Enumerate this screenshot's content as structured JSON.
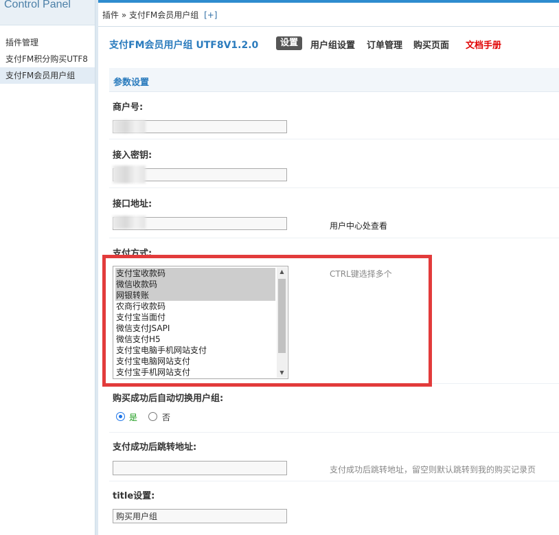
{
  "sidebar": {
    "brand": "Control Panel",
    "items": [
      {
        "label": "插件管理",
        "active": false
      },
      {
        "label": "支付FM积分购买UTF8",
        "active": false
      },
      {
        "label": "支付FM会员用户组",
        "active": true
      }
    ]
  },
  "topbar": {
    "breadcrumb": "插件 » 支付FM会员用户组",
    "add_label": "[+]"
  },
  "header": {
    "plugin_title": "支付FM会员用户组 UTF8V1.2.0",
    "nav": {
      "settings": "设置",
      "group_settings": "用户组设置",
      "orders": "订单管理",
      "buy_page": "购买页面",
      "docs": "文档手册"
    },
    "doc_color": "#e00000"
  },
  "section": {
    "title": "参数设置"
  },
  "fields": {
    "merchant_id": {
      "label": "商户号:",
      "value": ""
    },
    "access_key": {
      "label": "接入密钥:",
      "value": ""
    },
    "api_url": {
      "label": "接口地址:",
      "value": "",
      "hint": "用户中心处查看"
    },
    "payment_methods": {
      "label": "支付方式:",
      "hint": "CTRL键选择多个",
      "options": [
        {
          "label": "支付宝收款码",
          "selected": true
        },
        {
          "label": "微信收款码",
          "selected": true
        },
        {
          "label": "网银转账",
          "selected": true
        },
        {
          "label": "农商行收款码",
          "selected": false
        },
        {
          "label": "支付宝当面付",
          "selected": false
        },
        {
          "label": "微信支付JSAPI",
          "selected": false
        },
        {
          "label": "微信支付H5",
          "selected": false
        },
        {
          "label": "支付宝电脑手机网站支付",
          "selected": false
        },
        {
          "label": "支付宝电脑网站支付",
          "selected": false
        },
        {
          "label": "支付宝手机网站支付",
          "selected": false
        }
      ]
    },
    "auto_switch": {
      "label": "购买成功后自动切换用户组:",
      "yes": "是",
      "no": "否",
      "selected": "yes",
      "yes_color": "#1a9a1a"
    },
    "redirect_url": {
      "label": "支付成功后跳转地址:",
      "value": "",
      "hint": "支付成功后跳转地址，留空则默认跳转到我的购买记录页"
    },
    "title_setting": {
      "label": "title设置:",
      "value": "购买用户组"
    }
  },
  "colors": {
    "accent": "#2e8ccf",
    "title_blue": "#2a7bbd",
    "highlight_red": "#e23b3b"
  }
}
